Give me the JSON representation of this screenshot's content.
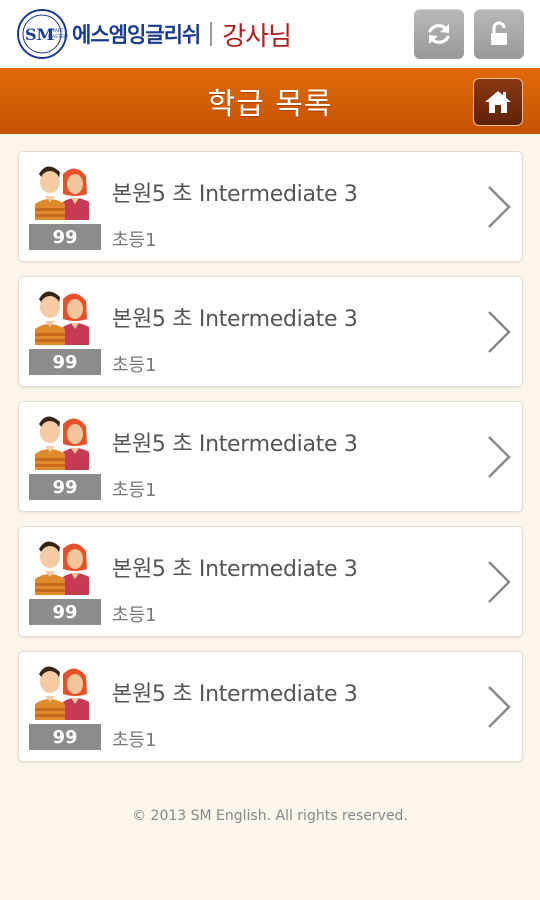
{
  "header": {
    "brand": "에스엠잉글리쉬",
    "role": "강사님",
    "logo_alt": "SM SMART MASTERS",
    "refresh_icon": "refresh-icon",
    "lock_icon": "lock-icon"
  },
  "titlebar": {
    "title": "학급 목록",
    "home_icon": "home-icon"
  },
  "classes": [
    {
      "name": "본원5 초 Intermediate 3",
      "grade": "초등1",
      "count": "99"
    },
    {
      "name": "본원5 초 Intermediate 3",
      "grade": "초등1",
      "count": "99"
    },
    {
      "name": "본원5 초 Intermediate 3",
      "grade": "초등1",
      "count": "99"
    },
    {
      "name": "본원5 초 Intermediate 3",
      "grade": "초등1",
      "count": "99"
    },
    {
      "name": "본원5 초 Intermediate 3",
      "grade": "초등1",
      "count": "99"
    }
  ],
  "footer": "© 2013 SM English. All rights reserved.",
  "colors": {
    "accent": "#d45d06",
    "brand_blue": "#1a3b8f",
    "role_red": "#b31c1c",
    "background": "#fbf6e9"
  }
}
